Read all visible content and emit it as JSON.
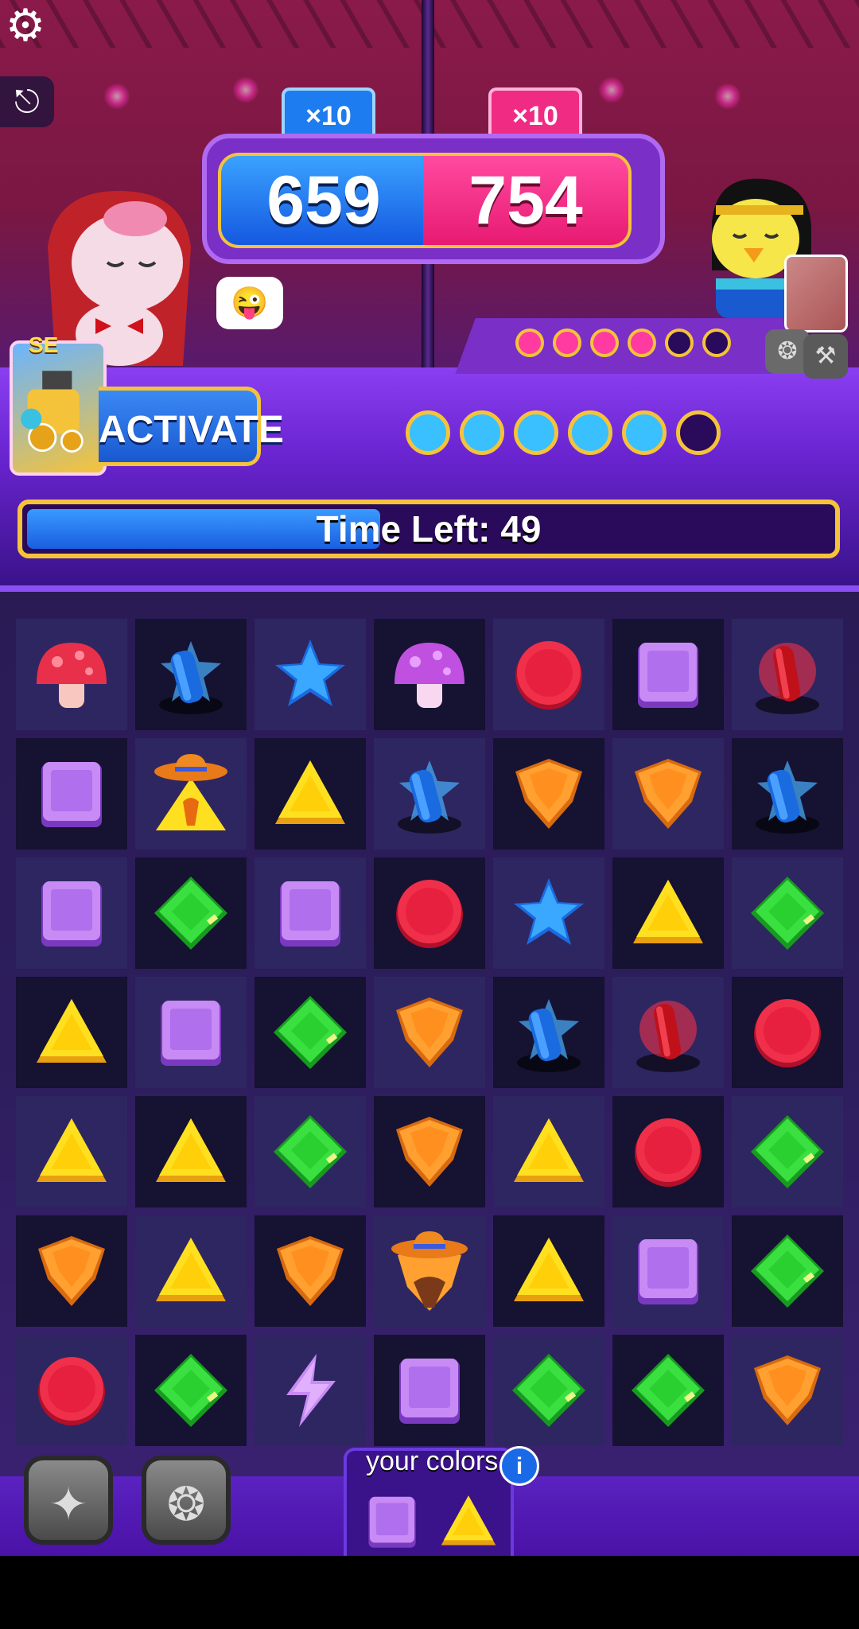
{
  "header": {
    "settings_icon": "gear-icon",
    "exit_icon": "exit-icon"
  },
  "scoreboard": {
    "player_multiplier": "×10",
    "opponent_multiplier": "×10",
    "player_score": "659",
    "opponent_score": "754",
    "player_color": "#1d7cf0",
    "opponent_color": "#f02b84"
  },
  "player": {
    "card_tag": "SE",
    "activate_label": "ACTIVATE",
    "charge_filled": 5,
    "charge_total": 6,
    "emote_icon": "emote-icon"
  },
  "opponent": {
    "charge_filled": 4,
    "charge_total": 6
  },
  "timer": {
    "label": "Time Left: 49",
    "fraction_left": 0.44
  },
  "board": {
    "rows": [
      [
        "mushroom-red",
        "dynamite-blue",
        "star",
        "mushroom-purple",
        "circle",
        "square",
        "dynamite-red"
      ],
      [
        "square",
        "cowboy-triangle",
        "triangle",
        "dynamite-blue",
        "diamond-orange",
        "diamond-orange",
        "dynamite-blue"
      ],
      [
        "square",
        "diamond-green",
        "square",
        "circle",
        "star",
        "triangle",
        "diamond-green"
      ],
      [
        "triangle",
        "square",
        "diamond-green",
        "diamond-orange",
        "dynamite-blue",
        "dynamite-red",
        "circle"
      ],
      [
        "triangle",
        "triangle",
        "diamond-green",
        "diamond-orange",
        "triangle",
        "circle",
        "diamond-green"
      ],
      [
        "diamond-orange",
        "triangle",
        "diamond-orange",
        "cowboy-orange",
        "triangle",
        "square",
        "diamond-green"
      ],
      [
        "circle",
        "diamond-green",
        "lightning",
        "square",
        "diamond-green",
        "diamond-green",
        "diamond-orange"
      ]
    ],
    "dark_cells": [
      [
        0,
        1
      ],
      [
        0,
        3
      ],
      [
        0,
        5
      ],
      [
        1,
        0
      ],
      [
        1,
        2
      ],
      [
        1,
        4
      ],
      [
        1,
        6
      ],
      [
        2,
        1
      ],
      [
        2,
        3
      ],
      [
        2,
        5
      ],
      [
        3,
        0
      ],
      [
        3,
        2
      ],
      [
        3,
        4
      ],
      [
        3,
        6
      ],
      [
        4,
        1
      ],
      [
        4,
        3
      ],
      [
        4,
        5
      ],
      [
        5,
        0
      ],
      [
        5,
        2
      ],
      [
        5,
        4
      ],
      [
        5,
        6
      ],
      [
        6,
        1
      ],
      [
        6,
        3
      ],
      [
        6,
        5
      ]
    ]
  },
  "footer": {
    "boosters": [
      "stars-booster-icon",
      "scarab-booster-icon"
    ],
    "colors_label": "your colors",
    "info_label": "i",
    "your_colors": [
      "square",
      "triangle"
    ]
  }
}
